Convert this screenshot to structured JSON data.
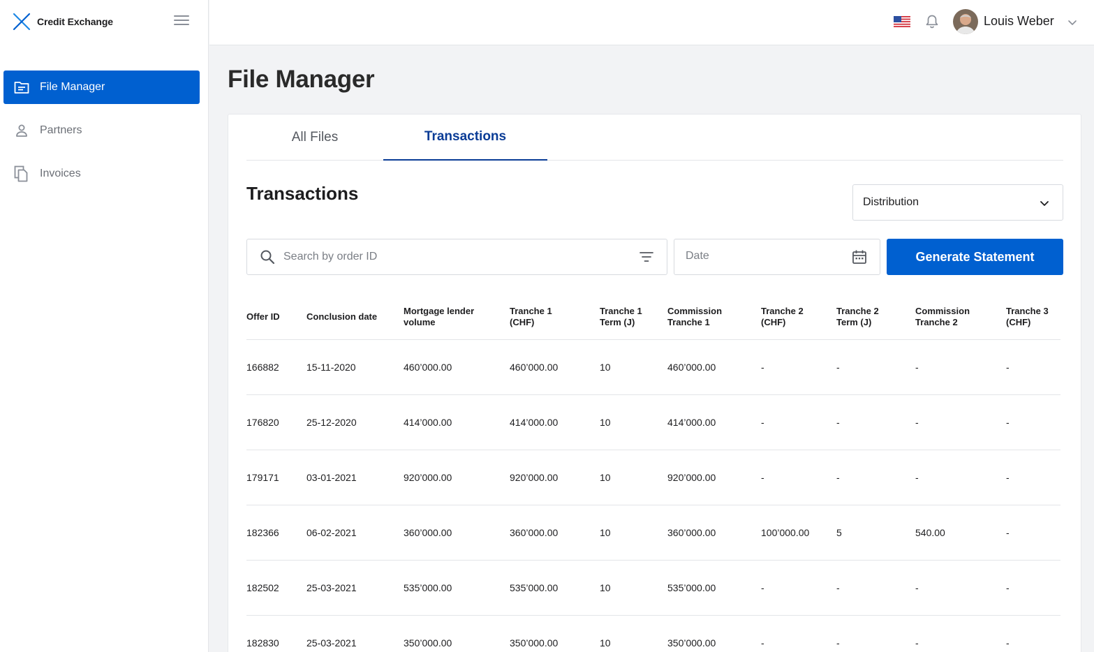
{
  "brand": {
    "name": "Credit Exchange"
  },
  "sidebar": {
    "items": [
      {
        "label": "File Manager",
        "icon": "folder-icon",
        "active": true
      },
      {
        "label": "Partners",
        "icon": "person-icon",
        "active": false
      },
      {
        "label": "Invoices",
        "icon": "documents-icon",
        "active": false
      }
    ]
  },
  "topbar": {
    "user_name": "Louis Weber",
    "language_flag": "us-flag-icon"
  },
  "page": {
    "title": "File Manager"
  },
  "tabs": [
    {
      "label": "All Files",
      "active": false
    },
    {
      "label": "Transactions",
      "active": true
    }
  ],
  "section": {
    "title": "Transactions"
  },
  "filters": {
    "distribution_select": "Distribution",
    "search_placeholder": "Search by order ID",
    "date_placeholder": "Date",
    "generate_label": "Generate Statement"
  },
  "table": {
    "headers": [
      [
        "Offer ID"
      ],
      [
        "Conclusion date"
      ],
      [
        "Mortgage lender",
        "volume"
      ],
      [
        "Tranche 1",
        "(CHF)"
      ],
      [
        "Tranche 1",
        "Term (J)"
      ],
      [
        "Commission",
        "Tranche 1"
      ],
      [
        "Tranche 2",
        "(CHF)"
      ],
      [
        "Tranche 2",
        "Term (J)"
      ],
      [
        "Commission",
        "Tranche 2"
      ],
      [
        "Tranche 3",
        "(CHF)"
      ]
    ],
    "rows": [
      [
        "166882",
        "15-11-2020",
        "460’000.00",
        "460’000.00",
        "10",
        "460’000.00",
        "-",
        "-",
        "-",
        "-"
      ],
      [
        "176820",
        "25-12-2020",
        "414’000.00",
        "414’000.00",
        "10",
        "414’000.00",
        "-",
        "-",
        "-",
        "-"
      ],
      [
        "179171",
        "03-01-2021",
        "920’000.00",
        "920’000.00",
        "10",
        "920’000.00",
        "-",
        "-",
        "-",
        "-"
      ],
      [
        "182366",
        "06-02-2021",
        "360’000.00",
        "360’000.00",
        "10",
        "360’000.00",
        "100’000.00",
        "5",
        "540.00",
        "-"
      ],
      [
        "182502",
        "25-03-2021",
        "535’000.00",
        "535’000.00",
        "10",
        "535’000.00",
        "-",
        "-",
        "-",
        "-"
      ],
      [
        "182830",
        "25-03-2021",
        "350’000.00",
        "350’000.00",
        "10",
        "350’000.00",
        "-",
        "-",
        "-",
        "-"
      ]
    ]
  },
  "colors": {
    "primary": "#0060d0",
    "tab_active": "#0a3c96",
    "border": "#e3e5e8"
  }
}
